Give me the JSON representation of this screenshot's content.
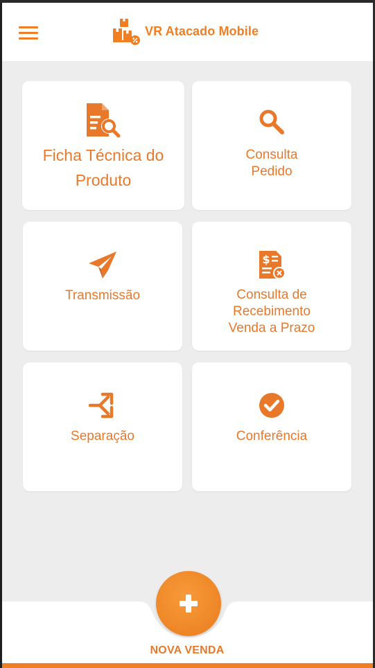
{
  "app": {
    "title": "VR Atacado Mobile",
    "accent_color": "#f07f24"
  },
  "header": {
    "menu_icon": "hamburger-menu-icon",
    "logo_icon": "boxes-percent-logo-icon"
  },
  "tiles": [
    {
      "label": "Ficha Técnica do\nProduto",
      "icon": "document-search-icon"
    },
    {
      "label": "Consulta\nPedido",
      "icon": "magnifier-icon"
    },
    {
      "label": "Transmissão",
      "icon": "paper-plane-icon"
    },
    {
      "label": "Consulta de\nRecebimento\nVenda a Prazo",
      "icon": "invoice-dollar-cancel-icon"
    },
    {
      "label": "Separação",
      "icon": "split-arrows-icon"
    },
    {
      "label": "Conferência",
      "icon": "check-circle-icon"
    }
  ],
  "bottom": {
    "fab_icon": "plus-icon",
    "fab_label": "NOVA VENDA"
  }
}
